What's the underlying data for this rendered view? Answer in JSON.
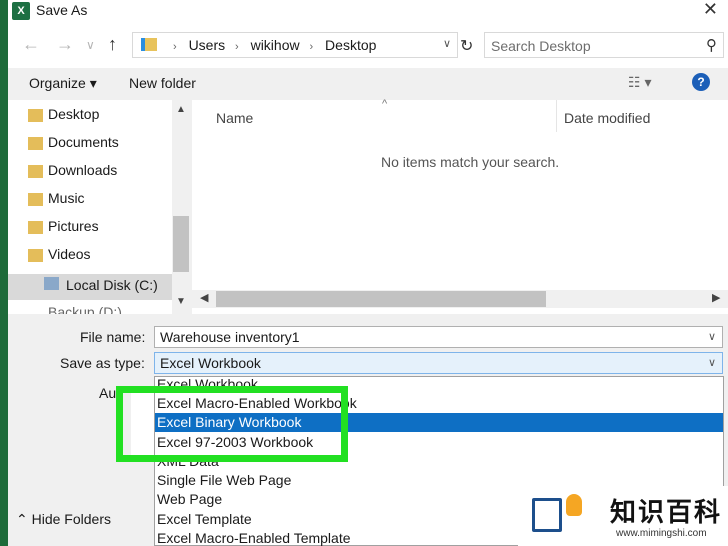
{
  "window": {
    "title": "Save As",
    "close_glyph": "✕"
  },
  "nav": {
    "back_glyph": "←",
    "forward_glyph": "→",
    "history_glyph": "∨",
    "up_glyph": "↑",
    "path": [
      "Users",
      "wikihow",
      "Desktop"
    ],
    "refresh_glyph": "↻",
    "search_placeholder": "Search Desktop",
    "search_glyph": "⚲"
  },
  "toolbar": {
    "organize": "Organize ▾",
    "new_folder": "New folder",
    "help": "?"
  },
  "sidebar": {
    "items": [
      "Desktop",
      "Documents",
      "Downloads",
      "Music",
      "Pictures",
      "Videos",
      "Local Disk (C:)",
      "Backup (D:)"
    ]
  },
  "file_list": {
    "columns": [
      "Name",
      "Date modified"
    ],
    "empty_message": "No items match your search."
  },
  "form": {
    "file_name_label": "File name:",
    "file_name_value": "Warehouse inventory1",
    "save_type_label": "Save as type:",
    "save_type_value": "Excel Workbook",
    "authors_partial": "Au",
    "hide_folders": "Hide Folders"
  },
  "dropdown": {
    "options": [
      "Excel Workbook",
      "Excel Macro-Enabled Workbook",
      "Excel Binary Workbook",
      "Excel 97-2003 Workbook",
      "XML Data",
      "Single File Web Page",
      "Web Page",
      "Excel Template",
      "Excel Macro-Enabled Template"
    ],
    "highlighted": "Excel Binary Workbook"
  },
  "watermark": {
    "chinese": "知识百科",
    "url": "www.mimingshi.com"
  },
  "colors": {
    "highlight": "#0e6fc4",
    "annotation": "#22e022",
    "excel_green": "#1d7043"
  }
}
